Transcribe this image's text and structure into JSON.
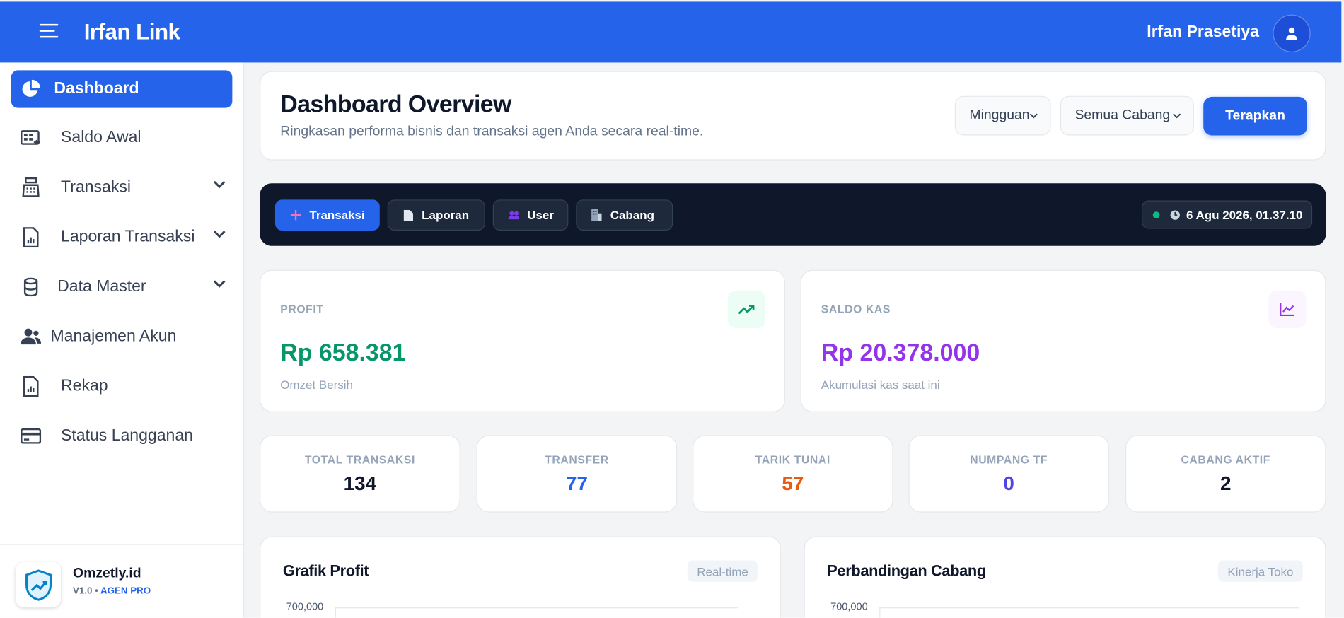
{
  "app": {
    "brand": "Irfan Link",
    "user_name": "Irfan Prasetiya"
  },
  "sidebar": {
    "items": [
      {
        "label": "Dashboard",
        "icon": "pie-chart-icon",
        "active": true
      },
      {
        "label": "Saldo Awal",
        "icon": "cash-register-icon"
      },
      {
        "label": "Transaksi",
        "icon": "calculator-icon",
        "expandable": true
      },
      {
        "label": "Laporan Transaksi",
        "icon": "report-icon",
        "expandable": true
      },
      {
        "label": "Data Master",
        "icon": "database-icon",
        "expandable": true
      },
      {
        "label": "Manajemen Akun",
        "icon": "users-icon"
      },
      {
        "label": "Rekap",
        "icon": "file-chart-icon"
      },
      {
        "label": "Status Langganan",
        "icon": "credit-card-icon"
      }
    ],
    "footer": {
      "title": "Omzetly.id",
      "version": "V1.0 •",
      "plan": "AGEN PRO"
    }
  },
  "header": {
    "title": "Dashboard Overview",
    "subtitle": "Ringkasan performa bisnis dan transaksi agen Anda secara real-time.",
    "period_select": "Mingguan",
    "branch_select": "Semua Cabang",
    "apply_label": "Terapkan"
  },
  "quickbar": {
    "buttons": [
      {
        "label": "Transaksi",
        "icon": "plus-icon"
      },
      {
        "label": "Laporan",
        "icon": "document-icon"
      },
      {
        "label": "User",
        "icon": "users-icon"
      },
      {
        "label": "Cabang",
        "icon": "building-icon"
      }
    ],
    "datetime": "6 Agu 2026, 01.37.10"
  },
  "stats": {
    "profit": {
      "label": "PROFIT",
      "value": "Rp 658.381",
      "note": "Omzet Bersih",
      "color": "#059669"
    },
    "saldo_kas": {
      "label": "SALDO KAS",
      "value": "Rp 20.378.000",
      "note": "Akumulasi kas saat ini",
      "color": "#9333ea"
    }
  },
  "mini_stats": [
    {
      "label": "TOTAL TRANSAKSI",
      "value": "134",
      "color": "#0f172a"
    },
    {
      "label": "TRANSFER",
      "value": "77",
      "color": "#2563eb"
    },
    {
      "label": "TARIK TUNAI",
      "value": "57",
      "color": "#ea580c"
    },
    {
      "label": "NUMPANG TF",
      "value": "0",
      "color": "#4f46e5"
    },
    {
      "label": "CABANG AKTIF",
      "value": "2",
      "color": "#0f172a"
    }
  ],
  "charts": {
    "profit": {
      "title": "Grafik Profit",
      "tag": "Real-time",
      "top_tick": "700,000"
    },
    "branch": {
      "title": "Perbandingan Cabang",
      "tag": "Kinerja Toko",
      "top_tick": "700,000"
    }
  }
}
